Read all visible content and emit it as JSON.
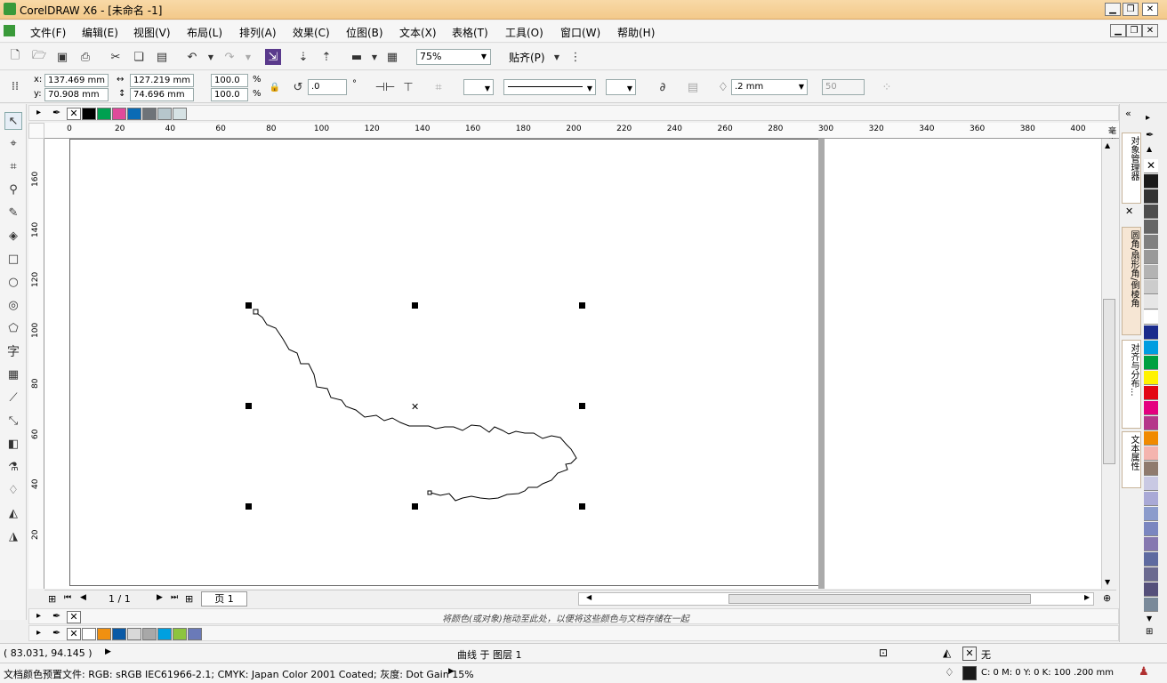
{
  "window": {
    "title": "CorelDRAW X6 - [未命名 -1]"
  },
  "menu": [
    "文件(F)",
    "编辑(E)",
    "视图(V)",
    "布局(L)",
    "排列(A)",
    "效果(C)",
    "位图(B)",
    "文本(X)",
    "表格(T)",
    "工具(O)",
    "窗口(W)",
    "帮助(H)"
  ],
  "toolbar": {
    "zoom": "75%",
    "snap": "贴齐(P)"
  },
  "props": {
    "x_label": "x:",
    "x": "137.469 mm",
    "y_label": "y:",
    "y": "70.908 mm",
    "w": "127.219 mm",
    "h": "74.696 mm",
    "sx": "100.0",
    "sy": "100.0",
    "pct": "%",
    "angle": ".0",
    "deg": "°",
    "outline_width": ".2 mm",
    "nib": "50"
  },
  "ruler": {
    "h_ticks": [
      "0",
      "20",
      "40",
      "60",
      "80",
      "100",
      "120",
      "140",
      "160",
      "180",
      "200",
      "220",
      "240",
      "260",
      "280",
      "300",
      "320",
      "340",
      "360",
      "380",
      "400"
    ],
    "unit": "毫米",
    "v_ticks": [
      "160",
      "140",
      "120",
      "100",
      "80",
      "60",
      "40",
      "20"
    ]
  },
  "pages": {
    "current": "1 / 1",
    "tab": "页 1"
  },
  "doc_palette_hint": "将颜色(或对象)拖动至此处，以便将这些颜色与文档存储在一起",
  "top_palette": [
    "#000000",
    "#00a050",
    "#e04a9a",
    "#0a6bb5",
    "#6e7378",
    "#b6c6cc",
    "#d6e2e4"
  ],
  "bottom_palette": [
    "#ffffff",
    "#f09010",
    "#0a5aa6",
    "#d8d8d8",
    "#a8a8a8",
    "#00a0e0",
    "#8dc43e",
    "#6a7ab8"
  ],
  "right_palette": [
    "#1a1a1a",
    "#333333",
    "#4d4d4d",
    "#666666",
    "#808080",
    "#999999",
    "#b3b3b3",
    "#cccccc",
    "#e6e6e6",
    "#ffffff",
    "#1a2b8c",
    "#009de0",
    "#00a040",
    "#fff200",
    "#e30613",
    "#e4007f",
    "#b5378a",
    "#f08a00",
    "#f4b4ae",
    "#8f7b6e",
    "#c9c9e3",
    "#a9a9d6",
    "#8c9ccc",
    "#7b86c0",
    "#8678b0",
    "#5e6aa0",
    "#6b6a90",
    "#55507a",
    "#7a8a9a"
  ],
  "dockers": [
    "对象管理器",
    "圆角/扇形角/倒棱角",
    "对齐与分布...",
    "文本属性"
  ],
  "status": {
    "coords": "( 83.031, 94.145 )",
    "object_info": "曲线 于 图层 1",
    "fill": "无",
    "color_profile": "文档颜色预置文件: RGB: sRGB IEC61966-2.1; CMYK: Japan Color 2001 Coated; 灰度: Dot Gain 15%",
    "outline": "C: 0 M: 0 Y: 0 K: 100  .200 mm"
  }
}
